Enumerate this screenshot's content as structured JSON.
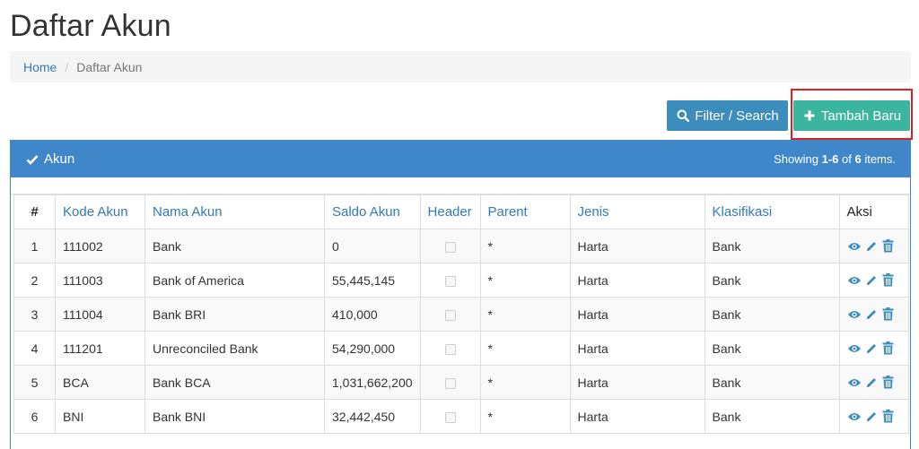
{
  "page": {
    "title": "Daftar Akun"
  },
  "breadcrumb": {
    "home": "Home",
    "separator": "/",
    "current": "Daftar Akun"
  },
  "toolbar": {
    "filter_label": "Filter / Search",
    "add_label": "Tambah Baru"
  },
  "panel": {
    "title": "Akun",
    "summary_prefix": "Showing ",
    "summary_range": "1-6",
    "summary_of": " of ",
    "summary_total": "6",
    "summary_suffix": " items."
  },
  "table": {
    "headers": [
      "#",
      "Kode Akun",
      "Nama Akun",
      "Saldo Akun",
      "Header",
      "Parent",
      "Jenis",
      "Klasifikasi",
      "Aksi"
    ],
    "rows": [
      {
        "no": "1",
        "kode": "111002",
        "nama": "Bank",
        "saldo": "0",
        "parent": "*",
        "jenis": "Harta",
        "klasifikasi": "Bank"
      },
      {
        "no": "2",
        "kode": "111003",
        "nama": "Bank of America",
        "saldo": "55,445,145",
        "parent": "*",
        "jenis": "Harta",
        "klasifikasi": "Bank"
      },
      {
        "no": "3",
        "kode": "111004",
        "nama": "Bank BRI",
        "saldo": "410,000",
        "parent": "*",
        "jenis": "Harta",
        "klasifikasi": "Bank"
      },
      {
        "no": "4",
        "kode": "111201",
        "nama": "Unreconciled Bank",
        "saldo": "54,290,000",
        "parent": "*",
        "jenis": "Harta",
        "klasifikasi": "Bank"
      },
      {
        "no": "5",
        "kode": "BCA",
        "nama": "Bank BCA",
        "saldo": "1,031,662,200",
        "parent": "*",
        "jenis": "Harta",
        "klasifikasi": "Bank"
      },
      {
        "no": "6",
        "kode": "BNI",
        "nama": "Bank BNI",
        "saldo": "32,442,450",
        "parent": "*",
        "jenis": "Harta",
        "klasifikasi": "Bank"
      }
    ]
  },
  "colors": {
    "primary": "#3c8dbc",
    "teal": "#3cb5a0",
    "panel_header": "#4087c9",
    "link": "#337ab7",
    "highlight": "#e02020"
  },
  "icons": {
    "filter": "search-icon",
    "add": "plus-icon",
    "panel": "check-icon",
    "view": "eye-icon",
    "edit": "pencil-icon",
    "delete": "trash-icon"
  }
}
